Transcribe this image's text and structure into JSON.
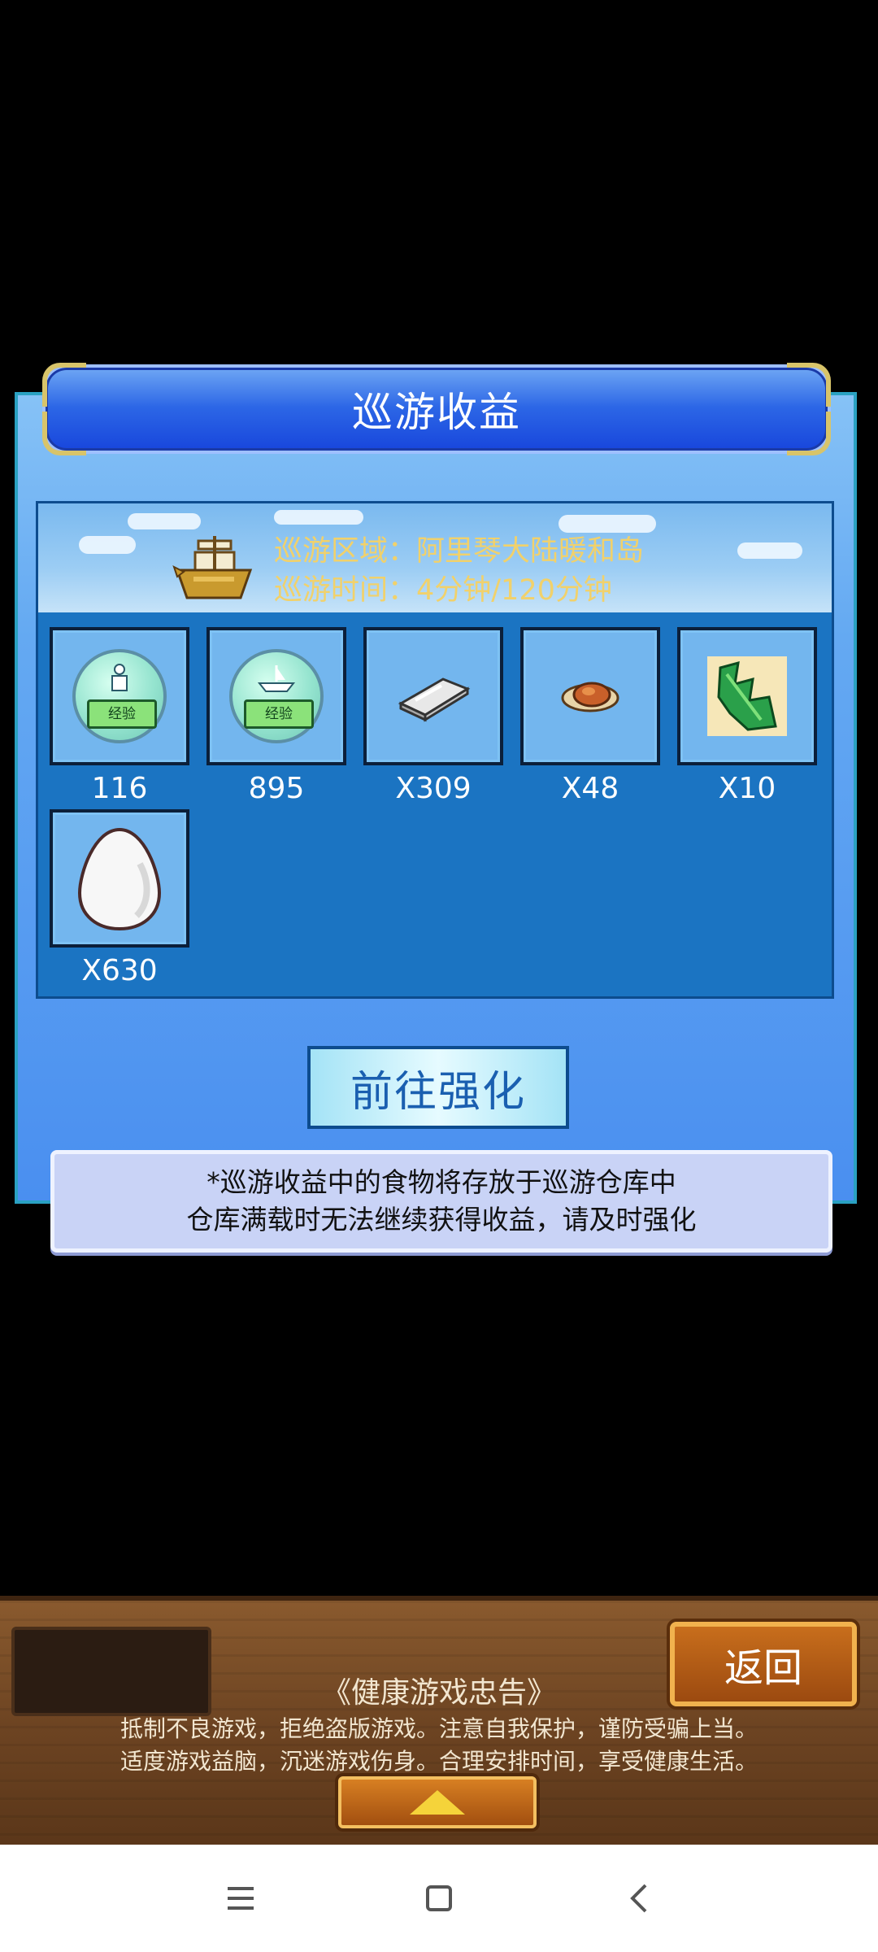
{
  "dialog": {
    "title": "巡游收益",
    "area_text": "巡游区域：阿里琴大陆暖和岛",
    "time_text": "巡游时间：4分钟/120分钟",
    "rewards": [
      {
        "icon": "exp-bubble-person-icon",
        "tag": "经验",
        "label": "116"
      },
      {
        "icon": "exp-bubble-ship-icon",
        "tag": "经验",
        "label": "895"
      },
      {
        "icon": "silver-bar-icon",
        "label": "X309"
      },
      {
        "icon": "meat-icon",
        "label": "X48"
      },
      {
        "icon": "green-leaf-card-icon",
        "label": "X10"
      },
      {
        "icon": "egg-icon",
        "label": "X630"
      }
    ],
    "go_button_label": "前往强化",
    "note_line1": "*巡游收益中的食物将存放于巡游仓库中",
    "note_line2": "仓库满载时无法继续获得收益，请及时强化"
  },
  "footer": {
    "back_label": "返回",
    "health_title": "《健康游戏忠告》",
    "health_line1": "抵制不良游戏，拒绝盗版游戏。注意自我保护，谨防受骗上当。",
    "health_line2": "适度游戏益脑，沉迷游戏伤身。合理安排时间，享受健康生活。"
  },
  "nav": {
    "menu_icon": "menu-icon",
    "home_icon": "home-icon",
    "back_icon": "back-icon"
  },
  "colors": {
    "title_blue": "#1846dc",
    "panel_blue": "#4a8ff0",
    "area_text": "#f1d16b",
    "go_button_text": "#1a5fb0",
    "back_button": "#9c4a10"
  }
}
